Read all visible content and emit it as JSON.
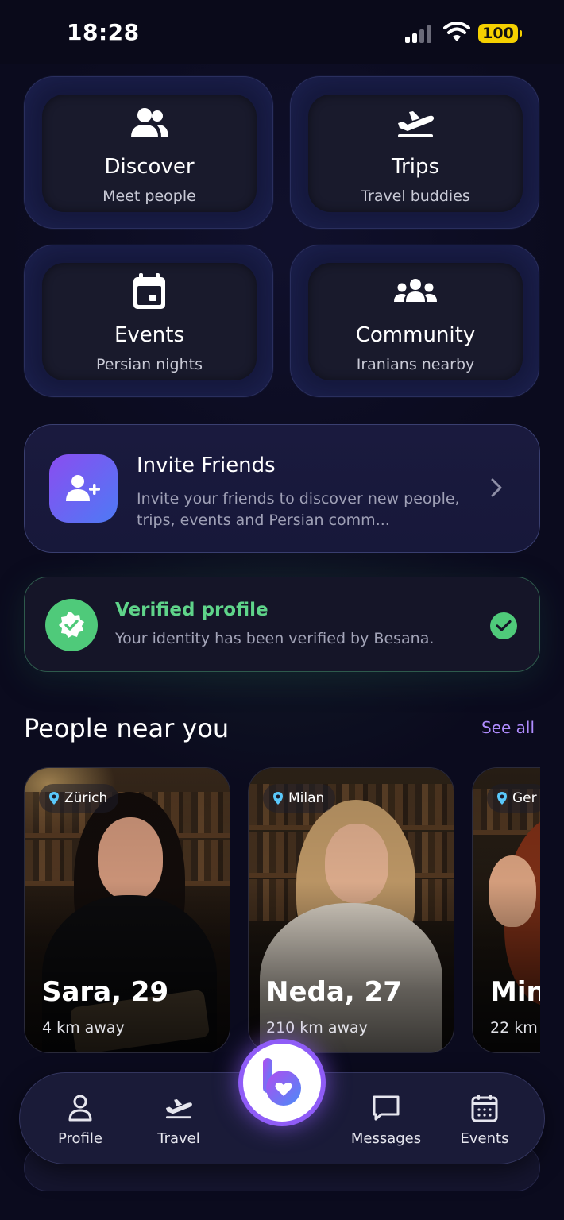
{
  "status_bar": {
    "time": "18:28",
    "battery": "100"
  },
  "tiles": [
    {
      "title": "Discover",
      "subtitle": "Meet people",
      "icon": "users-icon"
    },
    {
      "title": "Trips",
      "subtitle": "Travel buddies",
      "icon": "plane-takeoff-icon"
    },
    {
      "title": "Events",
      "subtitle": "Persian nights",
      "icon": "calendar-icon"
    },
    {
      "title": "Community",
      "subtitle": "Iranians nearby",
      "icon": "group-icon"
    }
  ],
  "invite": {
    "title": "Invite Friends",
    "description": "Invite your friends to discover new people, trips, events and Persian comm..."
  },
  "verified": {
    "title": "Verified profile",
    "description": "Your identity has been verified by Besana."
  },
  "people": {
    "title": "People near you",
    "see_all": "See all",
    "cards": [
      {
        "location": "Zürich",
        "name": "Sara, 29",
        "distance": "4 km away"
      },
      {
        "location": "Milan",
        "name": "Neda, 27",
        "distance": "210 km away"
      },
      {
        "location": "Ger",
        "name": "Mina",
        "distance": "22 km"
      }
    ]
  },
  "nav": {
    "items": [
      {
        "label": "Profile",
        "icon": "person-icon"
      },
      {
        "label": "Travel",
        "icon": "plane-icon"
      },
      {
        "label": "Messages",
        "icon": "chat-icon"
      },
      {
        "label": "Events",
        "icon": "calendar-icon"
      }
    ]
  },
  "colors": {
    "accent": "#8f5cf7",
    "verified_green": "#4fca7a",
    "see_all": "#b08cff",
    "background": "#0b0b1e"
  }
}
